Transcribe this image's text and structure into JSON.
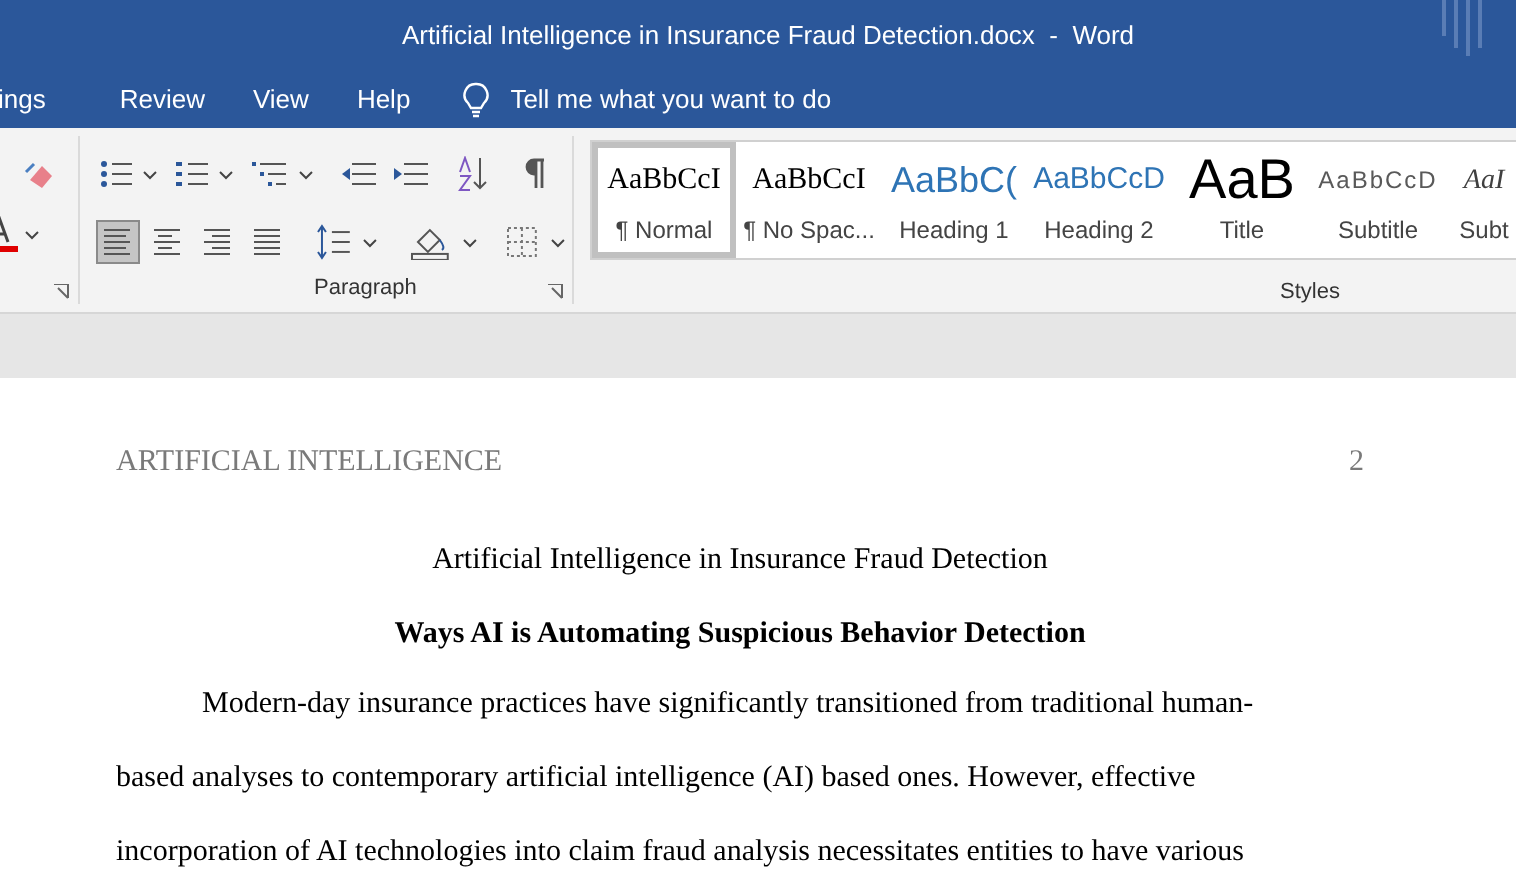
{
  "window": {
    "title": "Artificial Intelligence in Insurance Fraud Detection.docx  -  Word"
  },
  "tabs": [
    {
      "label": "ings"
    },
    {
      "label": "Review"
    },
    {
      "label": "View"
    },
    {
      "label": "Help"
    }
  ],
  "tell_me": {
    "placeholder": "Tell me what you want to do"
  },
  "ribbon": {
    "paragraph_group": {
      "label": "Paragraph",
      "align": [
        {
          "selected": true
        },
        {
          "selected": false
        },
        {
          "selected": false
        },
        {
          "selected": false
        }
      ]
    },
    "styles_group": {
      "label": "Styles",
      "styles": [
        {
          "kind": "normal",
          "preview": "AaBbCcI",
          "label": "¶ Normal",
          "selected": true
        },
        {
          "kind": "no_spacing",
          "preview": "AaBbCcI",
          "label": "¶ No Spac...",
          "selected": false
        },
        {
          "kind": "heading1",
          "preview": "AaBbC(",
          "label": "Heading 1",
          "selected": false
        },
        {
          "kind": "heading2",
          "preview": "AaBbCcD",
          "label": "Heading 2",
          "selected": false
        },
        {
          "kind": "title",
          "preview": "AaB",
          "label": "Title",
          "selected": false
        },
        {
          "kind": "subtitle",
          "preview": "AaBbCcD",
          "label": "Subtitle",
          "selected": false
        },
        {
          "kind": "subtle",
          "preview": "AaI",
          "label": "Subt",
          "selected": false
        }
      ]
    }
  },
  "document": {
    "header": {
      "running_head": "ARTIFICIAL INTELLIGENCE",
      "page_number": "2"
    },
    "title": "Artificial Intelligence in Insurance Fraud Detection",
    "heading": "Ways AI is Automating Suspicious Behavior Detection",
    "paragraph": "Modern-day insurance practices have significantly transitioned from traditional human-based analyses to contemporary artificial intelligence (AI) based ones. However, effective incorporation of AI technologies into claim fraud analysis necessitates entities to have various"
  }
}
